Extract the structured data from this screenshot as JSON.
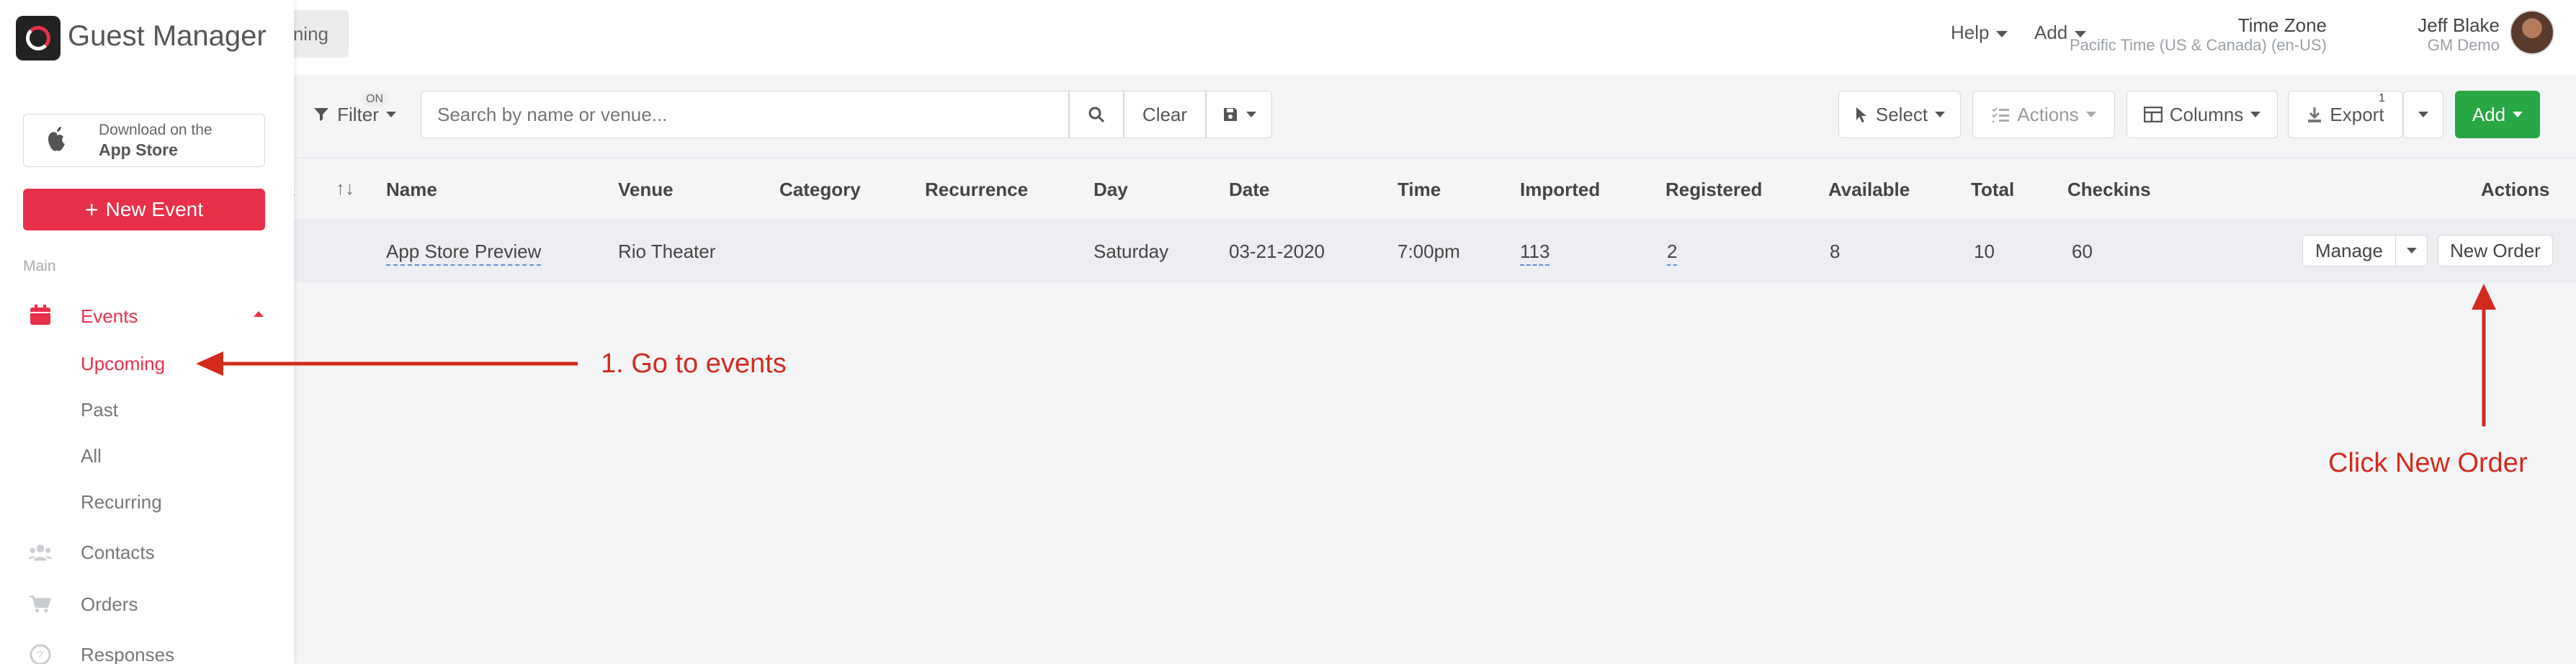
{
  "app": {
    "brand": "Guest Manager"
  },
  "header": {
    "tab_partial": "ning",
    "help_label": "Help",
    "add_label": "Add",
    "timezone_title": "Time Zone",
    "timezone_value": "Pacific Time (US & Canada) (en-US)",
    "user_name": "Jeff Blake",
    "user_org": "GM Demo"
  },
  "sidebar": {
    "appstore_line1": "Download on the",
    "appstore_line2": "App Store",
    "new_event_label": "New Event",
    "section_label": "Main",
    "events_label": "Events",
    "sub_items": [
      "Upcoming",
      "Past",
      "All",
      "Recurring"
    ],
    "contacts_label": "Contacts",
    "orders_label": "Orders",
    "responses_label": "Responses"
  },
  "toolbar": {
    "filter_label": "Filter",
    "filter_badge": "ON",
    "search_placeholder": "Search by name or venue...",
    "clear_label": "Clear",
    "select_label": "Select",
    "actions_label": "Actions",
    "columns_label": "Columns",
    "export_label": "Export",
    "export_count": "1",
    "add_label": "Add"
  },
  "table": {
    "columns": {
      "partial": "t",
      "name": "Name",
      "venue": "Venue",
      "category": "Category",
      "recurrence": "Recurrence",
      "day": "Day",
      "date": "Date",
      "time": "Time",
      "imported": "Imported",
      "registered": "Registered",
      "available": "Available",
      "total": "Total",
      "checkins": "Checkins",
      "actions": "Actions"
    },
    "rows": [
      {
        "name": "App Store Preview",
        "venue": "Rio Theater",
        "category": "",
        "recurrence": "",
        "day": "Saturday",
        "date": "03-21-2020",
        "time": "7:00pm",
        "imported": "113",
        "registered": "2",
        "available": "8",
        "total": "10",
        "checkins": "60",
        "manage_label": "Manage",
        "new_order_label": "New Order"
      }
    ]
  },
  "annotations": {
    "step1": "1. Go to events",
    "step2": "Click New Order",
    "color": "#d32a1e"
  },
  "colors": {
    "brand_red": "#e8304a",
    "add_green": "#28a745",
    "link_underline": "#5b8fd6"
  }
}
